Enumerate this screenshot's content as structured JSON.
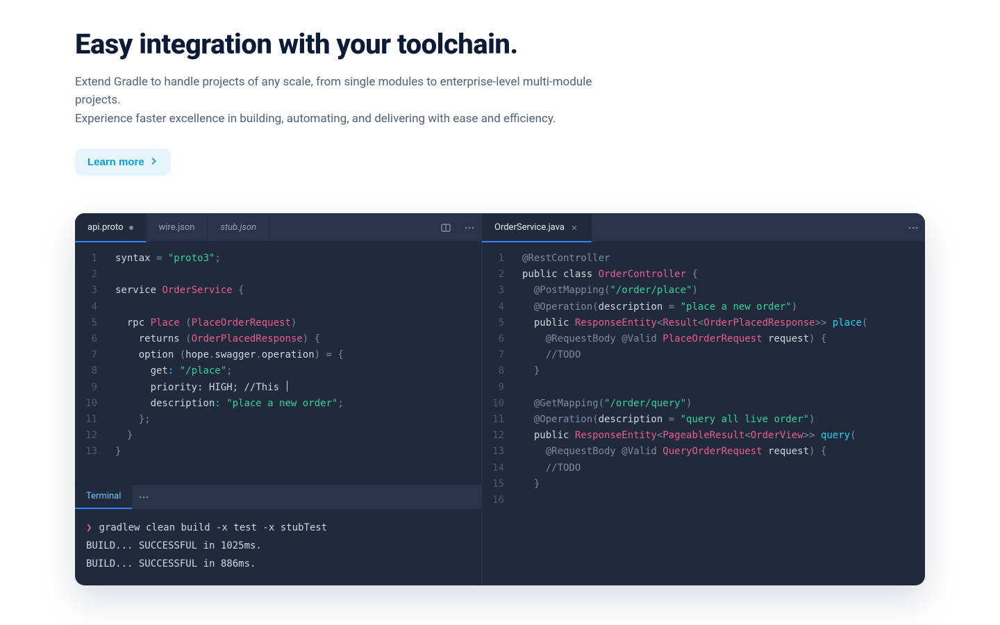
{
  "header": {
    "title": "Easy integration with your toolchain.",
    "subtitle1": "Extend Gradle to handle projects of any scale, from single modules to enterprise-level multi-module projects.",
    "subtitle2": "Experience faster excellence in building, automating, and delivering with ease and efficiency.",
    "learn_more": "Learn more"
  },
  "colors": {
    "accent_button_bg": "#e6f4fb",
    "accent_button_fg": "#069fe1",
    "ide_bg": "#202a3c"
  },
  "ide": {
    "left": {
      "tabs": [
        {
          "label": "api.proto",
          "active": true,
          "modified": true
        },
        {
          "label": "wire.json",
          "active": false
        },
        {
          "label": "stub.json",
          "active": false,
          "italic": true
        }
      ],
      "toolbar_icons": [
        "split-editor-icon",
        "more-icon"
      ],
      "code": [
        [
          {
            "c": "kw",
            "t": "syntax "
          },
          {
            "c": "punc",
            "t": "= "
          },
          {
            "c": "str",
            "t": "\"proto3\""
          },
          {
            "c": "punc",
            "t": ";"
          }
        ],
        [
          {
            "c": "kw",
            "t": ""
          }
        ],
        [
          {
            "c": "kw",
            "t": "service "
          },
          {
            "c": "pink",
            "t": "OrderService"
          },
          {
            "c": "punc",
            "t": " {"
          }
        ],
        [
          {
            "c": "kw",
            "t": ""
          }
        ],
        [
          {
            "c": "kw",
            "t": "  rpc "
          },
          {
            "c": "pink",
            "t": "Place"
          },
          {
            "c": "punc",
            "t": " ("
          },
          {
            "c": "pink",
            "t": "PlaceOrderRequest"
          },
          {
            "c": "punc",
            "t": ")"
          }
        ],
        [
          {
            "c": "kw",
            "t": "    returns "
          },
          {
            "c": "punc",
            "t": "("
          },
          {
            "c": "pink",
            "t": "OrderPlacedResponse"
          },
          {
            "c": "punc",
            "t": ") {"
          }
        ],
        [
          {
            "c": "kw",
            "t": "    option "
          },
          {
            "c": "punc",
            "t": "("
          },
          {
            "c": "kw",
            "t": "hope"
          },
          {
            "c": "punc",
            "t": "."
          },
          {
            "c": "kw",
            "t": "swagger"
          },
          {
            "c": "punc",
            "t": "."
          },
          {
            "c": "kw",
            "t": "operation"
          },
          {
            "c": "punc",
            "t": ") = {"
          }
        ],
        [
          {
            "c": "kw",
            "t": "      get"
          },
          {
            "c": "cyan",
            "t": ": "
          },
          {
            "c": "str",
            "t": "\"/place\""
          },
          {
            "c": "punc",
            "t": ";"
          }
        ],
        [
          {
            "c": "kw",
            "t": "      priority: HIGH; //This "
          },
          "__cursor__"
        ],
        [
          {
            "c": "kw",
            "t": "      description"
          },
          {
            "c": "cyan",
            "t": ": "
          },
          {
            "c": "str",
            "t": "\"place a new order\""
          },
          {
            "c": "punc",
            "t": ";"
          }
        ],
        [
          {
            "c": "punc",
            "t": "    };"
          }
        ],
        [
          {
            "c": "punc",
            "t": "  }"
          }
        ],
        [
          {
            "c": "punc",
            "t": "}"
          }
        ]
      ],
      "terminal": {
        "tab": "Terminal",
        "toolbar_icons": [
          "more-icon"
        ],
        "lines": [
          {
            "prompt": "❯",
            "text": "gradlew clean build -x test  -x stubTest"
          },
          {
            "text": "BUILD... SUCCESSFUL in 1025ms."
          },
          {
            "text": "BUILD... SUCCESSFUL in 886ms."
          }
        ]
      }
    },
    "right": {
      "tabs": [
        {
          "label": "OrderService.java",
          "active": true,
          "closable": true
        }
      ],
      "toolbar_icons": [
        "more-icon"
      ],
      "code": [
        [
          {
            "c": "punc",
            "t": "@RestController"
          }
        ],
        [
          {
            "c": "kw",
            "t": "public class "
          },
          {
            "c": "pink",
            "t": "OrderController"
          },
          {
            "c": "punc",
            "t": " {"
          }
        ],
        [
          {
            "c": "kw",
            "t": "  "
          },
          {
            "c": "punc",
            "t": "@PostMapping("
          },
          {
            "c": "str",
            "t": "\"/order/place\""
          },
          {
            "c": "punc",
            "t": ")"
          }
        ],
        [
          {
            "c": "kw",
            "t": "  "
          },
          {
            "c": "punc",
            "t": "@Operation("
          },
          {
            "c": "kw",
            "t": "description"
          },
          {
            "c": "punc",
            "t": " = "
          },
          {
            "c": "str",
            "t": "\"place a new order\""
          },
          {
            "c": "punc",
            "t": ")"
          }
        ],
        [
          {
            "c": "kw",
            "t": "  public "
          },
          {
            "c": "pink",
            "t": "ResponseEntity"
          },
          {
            "c": "punc",
            "t": "<"
          },
          {
            "c": "pink",
            "t": "Result"
          },
          {
            "c": "punc",
            "t": "<"
          },
          {
            "c": "pink",
            "t": "OrderPlacedResponse"
          },
          {
            "c": "punc",
            "t": ">> "
          },
          {
            "c": "cyan",
            "t": "place"
          },
          {
            "c": "punc",
            "t": "("
          }
        ],
        [
          {
            "c": "kw",
            "t": "    "
          },
          {
            "c": "punc",
            "t": "@RequestBody @Valid "
          },
          {
            "c": "pink",
            "t": "PlaceOrderRequest"
          },
          {
            "c": "kw",
            "t": " request"
          },
          {
            "c": "punc",
            "t": ") {"
          }
        ],
        [
          {
            "c": "punc",
            "t": "    //TODO"
          }
        ],
        [
          {
            "c": "punc",
            "t": "  }"
          }
        ],
        [
          {
            "c": "kw",
            "t": ""
          }
        ],
        [
          {
            "c": "kw",
            "t": "  "
          },
          {
            "c": "punc",
            "t": "@GetMapping("
          },
          {
            "c": "str",
            "t": "\"/order/query\""
          },
          {
            "c": "punc",
            "t": ")"
          }
        ],
        [
          {
            "c": "kw",
            "t": "  "
          },
          {
            "c": "punc",
            "t": "@Operation("
          },
          {
            "c": "kw",
            "t": "description"
          },
          {
            "c": "punc",
            "t": " = "
          },
          {
            "c": "str",
            "t": "\"query all live order\""
          },
          {
            "c": "punc",
            "t": ")"
          }
        ],
        [
          {
            "c": "kw",
            "t": "  public "
          },
          {
            "c": "pink",
            "t": "ResponseEntity"
          },
          {
            "c": "punc",
            "t": "<"
          },
          {
            "c": "pink",
            "t": "PageableResult"
          },
          {
            "c": "punc",
            "t": "<"
          },
          {
            "c": "pink",
            "t": "OrderView"
          },
          {
            "c": "punc",
            "t": ">> "
          },
          {
            "c": "cyan",
            "t": "query"
          },
          {
            "c": "punc",
            "t": "("
          }
        ],
        [
          {
            "c": "kw",
            "t": "    "
          },
          {
            "c": "punc",
            "t": "@RequestBody @Valid "
          },
          {
            "c": "pink",
            "t": "QueryOrderRequest"
          },
          {
            "c": "kw",
            "t": " request"
          },
          {
            "c": "punc",
            "t": ") {"
          }
        ],
        [
          {
            "c": "punc",
            "t": "    //TODO"
          }
        ],
        [
          {
            "c": "punc",
            "t": "  }"
          }
        ],
        [
          {
            "c": "kw",
            "t": ""
          }
        ]
      ]
    }
  }
}
